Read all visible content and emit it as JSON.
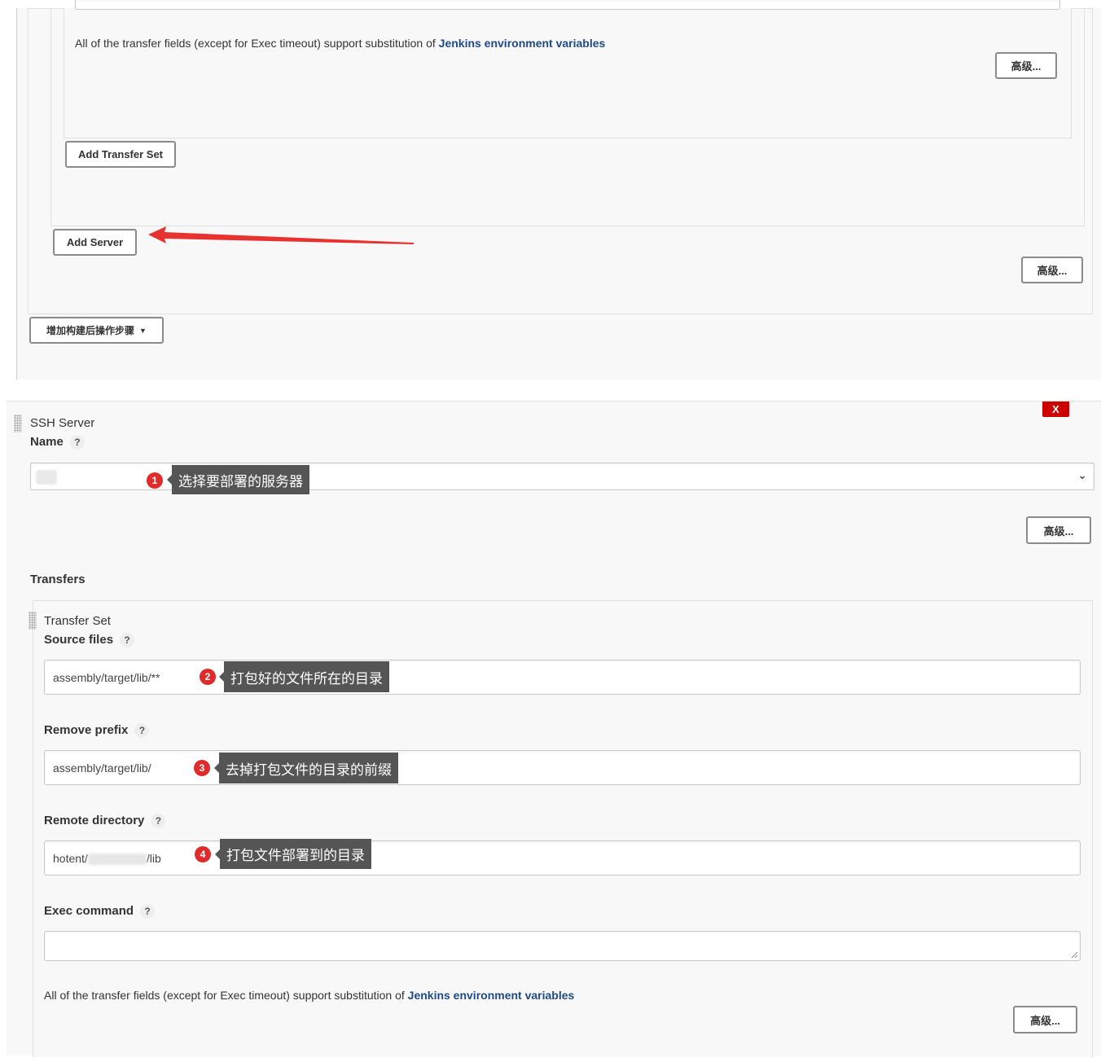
{
  "top_section": {
    "note_text": "All of the transfer fields (except for Exec timeout) support substitution of ",
    "note_link": "Jenkins environment variables",
    "advanced_label": "高级...",
    "add_transfer_set_label": "Add Transfer Set",
    "add_server_label": "Add Server",
    "advanced_label_2": "高级...",
    "add_post_build_label": "增加构建后操作步骤"
  },
  "ssh_server": {
    "section_title": "SSH Server",
    "close_label": "X",
    "name_label": "Name",
    "name_help": "?",
    "name_badge": "1",
    "name_tip": "选择要部署的服务器",
    "advanced_label": "高级..."
  },
  "transfers": {
    "heading": "Transfers",
    "set_title": "Transfer Set",
    "source_files": {
      "label": "Source files",
      "help": "?",
      "value": "assembly/target/lib/**",
      "badge": "2",
      "tip": "打包好的文件所在的目录"
    },
    "remove_prefix": {
      "label": "Remove prefix",
      "help": "?",
      "value": "assembly/target/lib/",
      "badge": "3",
      "tip": "去掉打包文件的目录的前缀"
    },
    "remote_directory": {
      "label": "Remote directory",
      "help": "?",
      "value_start": "hotent/",
      "value_end": "/lib",
      "badge": "4",
      "tip": "打包文件部署到的目录"
    },
    "exec_command": {
      "label": "Exec command",
      "help": "?",
      "value": ""
    },
    "note_text": "All of the transfer fields (except for Exec timeout) support substitution of ",
    "note_link": "Jenkins environment variables",
    "advanced_label": "高级..."
  },
  "colors": {
    "accent_link": "#204a87",
    "badge_red": "#e02b2b",
    "tooltip_bg": "#555555",
    "close_red": "#cc0000",
    "arrow_red": "#e8322f"
  }
}
